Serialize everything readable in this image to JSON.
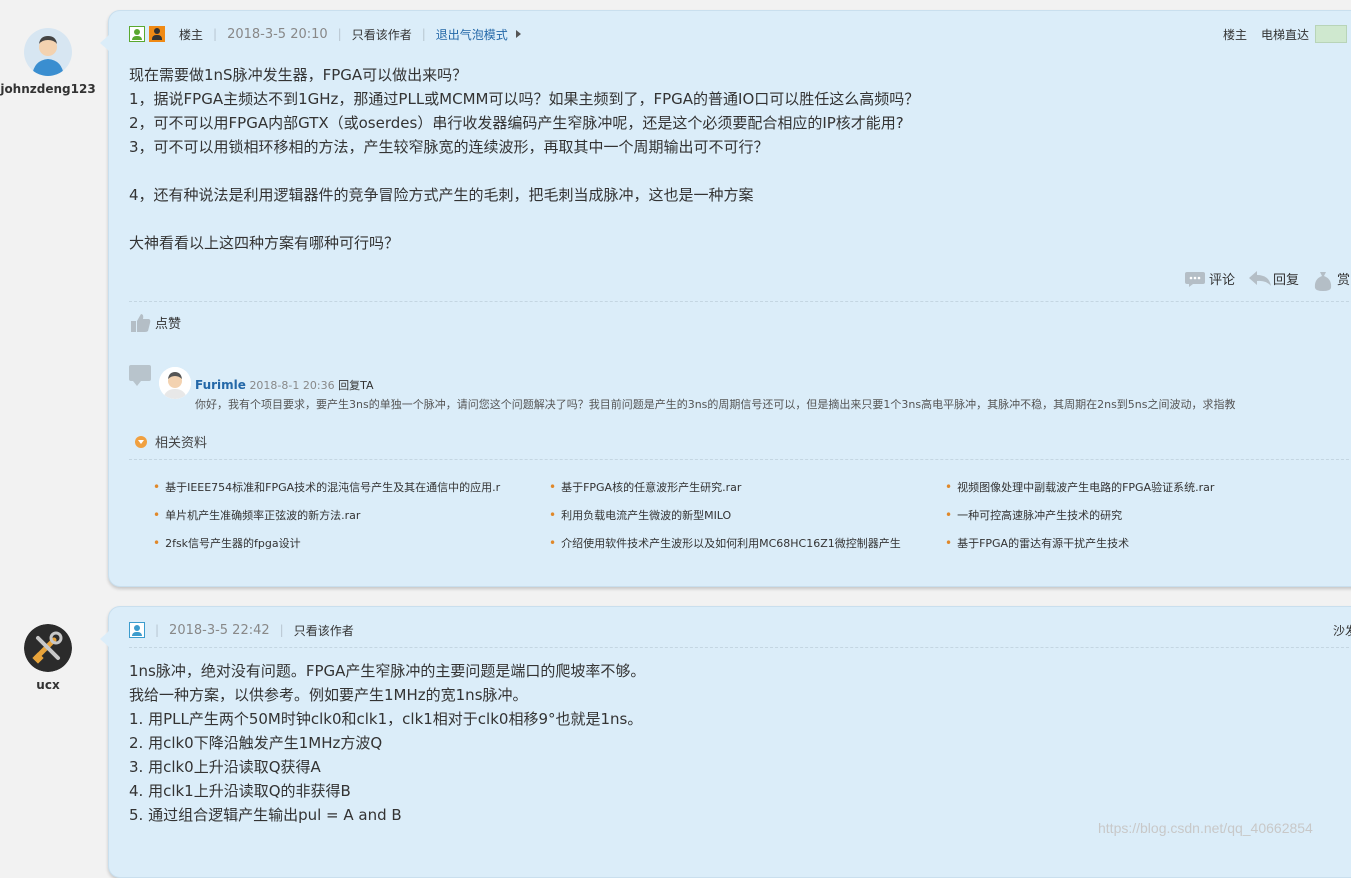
{
  "post1": {
    "author": "johnzdeng123",
    "role": "楼主",
    "time": "2018-3-5 20:10",
    "only_author": "只看该作者",
    "exit_bubble": "退出气泡模式",
    "floor_label": "楼主",
    "elevator": "电梯直达",
    "lines": [
      "现在需要做1nS脉冲发生器，FPGA可以做出来吗？",
      "1，据说FPGA主频达不到1GHz，那通过PLL或MCMM可以吗？如果主频到了，FPGA的普通IO口可以胜任这么高频吗？",
      "2，可不可以用FPGA内部GTX（或oserdes）串行收发器编码产生窄脉冲呢，还是这个必须要配合相应的IP核才能用?",
      "3，可不可以用锁相环移相的方法，产生较窄脉宽的连续波形，再取其中一个周期输出可不可行？",
      "",
      "4，还有种说法是利用逻辑器件的竞争冒险方式产生的毛刺，把毛刺当成脉冲，这也是一种方案",
      "",
      "大神看看以上这四种方案有哪种可行吗？"
    ],
    "actions": {
      "comment": "评论",
      "reply": "回复",
      "reward": "赏"
    },
    "like": "点赞",
    "comment": {
      "name": "Furimle",
      "time": "2018-8-1 20:36",
      "reply_ta": "回复TA",
      "text": "你好，我有个项目要求，要产生3ns的单独一个脉冲，请问您这个问题解决了吗？我目前问题是产生的3ns的周期信号还可以，但是摘出来只要1个3ns高电平脉冲，其脉冲不稳，其周期在2ns到5ns之间波动，求指教"
    },
    "related_title": "相关资料",
    "related": [
      "基于IEEE754标准和FPGA技术的混沌信号产生及其在通信中的应用.r",
      "基于FPGA核的任意波形产生研究.rar",
      "视频图像处理中副载波产生电路的FPGA验证系统.rar",
      "单片机产生准确频率正弦波的新方法.rar",
      "利用负载电流产生微波的新型MILO",
      "一种可控高速脉冲产生技术的研究",
      "2fsk信号产生器的fpga设计",
      "介绍使用软件技术产生波形以及如何利用MC68HC16Z1微控制器产生",
      "基于FPGA的雷达有源干扰产生技术"
    ]
  },
  "post2": {
    "author": "ucx",
    "time": "2018-3-5 22:42",
    "only_author": "只看该作者",
    "floor_label": "沙发",
    "lines": [
      "1ns脉冲，绝对没有问题。FPGA产生窄脉冲的主要问题是端口的爬坡率不够。",
      "我给一种方案，以供参考。例如要产生1MHz的宽1ns脉冲。",
      "1. 用PLL产生两个50M时钟clk0和clk1，clk1相对于clk0相移9°也就是1ns。",
      "2. 用clk0下降沿触发产生1MHz方波Q",
      "3. 用clk0上升沿读取Q获得A",
      "4. 用clk1上升沿读取Q的非获得B",
      "5. 通过组合逻辑产生输出pul = A and B"
    ]
  },
  "watermark": "https://blog.csdn.net/qq_40662854"
}
